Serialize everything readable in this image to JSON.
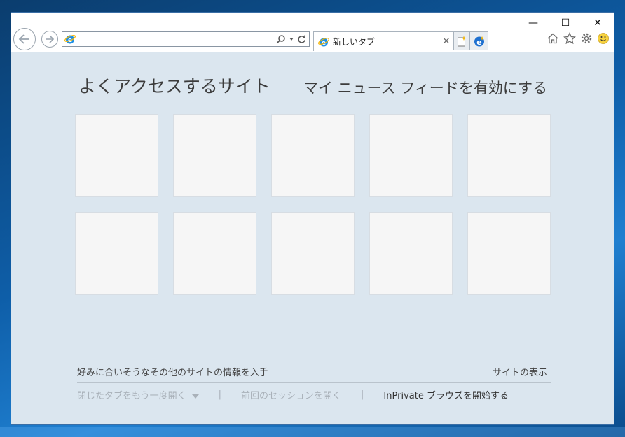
{
  "window": {
    "controls": {
      "minimize": "—",
      "maximize": "☐",
      "close": "✕"
    }
  },
  "address_bar": {
    "value": "",
    "placeholder": ""
  },
  "tab": {
    "label": "新しいタブ",
    "close": "✕"
  },
  "content": {
    "frequent_title": "よくアクセスするサイト",
    "news_link": "マイ ニュース フィードを有効にする",
    "tile_count": 10,
    "suggest_text": "好みに合いそうなその他のサイトの情報を入手",
    "show_sites": "サイトの表示",
    "footer": {
      "reopen_closed": "閉じたタブをもう一度開く",
      "sep1": "|",
      "reopen_session": "前回のセッションを開く",
      "sep2": "|",
      "inprivate": "InPrivate ブラウズを開始する"
    }
  },
  "icons": {
    "back": "back-arrow-icon",
    "forward": "forward-arrow-icon",
    "ie": "internet-explorer-icon",
    "search": "search-icon",
    "refresh": "refresh-icon",
    "new_tab": "new-tab-icon",
    "edge": "edge-icon",
    "home": "home-icon",
    "favorites": "star-icon",
    "tools": "gear-icon",
    "feedback": "smiley-icon"
  },
  "colors": {
    "content_bg": "#dbe6ef",
    "tile": "#f6f6f6",
    "ie_blue": "#1e90e6",
    "ie_ring": "#f4b400"
  }
}
